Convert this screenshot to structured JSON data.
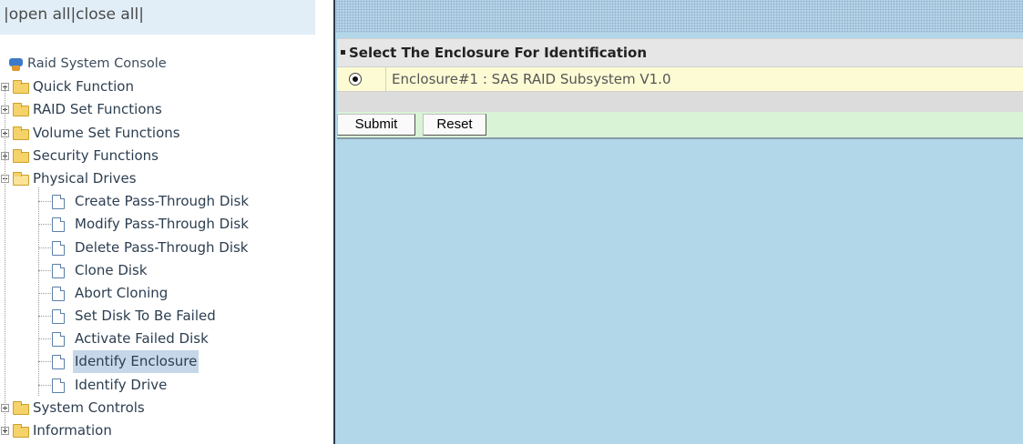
{
  "sidebar": {
    "open_all": "open all",
    "close_all": "close all",
    "pipe": "|",
    "tree": [
      {
        "label": "Raid System Console",
        "kind": "root"
      },
      {
        "label": "Quick Function",
        "kind": "folder",
        "expanded": false
      },
      {
        "label": "RAID Set Functions",
        "kind": "folder",
        "expanded": false
      },
      {
        "label": "Volume Set Functions",
        "kind": "folder",
        "expanded": false
      },
      {
        "label": "Security Functions",
        "kind": "folder",
        "expanded": false
      },
      {
        "label": "Physical Drives",
        "kind": "folder",
        "expanded": true
      },
      {
        "label": "Create Pass-Through Disk",
        "kind": "page"
      },
      {
        "label": "Modify Pass-Through Disk",
        "kind": "page"
      },
      {
        "label": "Delete Pass-Through Disk",
        "kind": "page"
      },
      {
        "label": "Clone Disk",
        "kind": "page"
      },
      {
        "label": "Abort Cloning",
        "kind": "page"
      },
      {
        "label": "Set Disk To Be Failed",
        "kind": "page"
      },
      {
        "label": "Activate Failed Disk",
        "kind": "page"
      },
      {
        "label": "Identify Enclosure",
        "kind": "page",
        "selected": true
      },
      {
        "label": "Identify Drive",
        "kind": "page"
      },
      {
        "label": "System Controls",
        "kind": "folder",
        "expanded": false
      },
      {
        "label": "Information",
        "kind": "folder",
        "expanded": false
      }
    ]
  },
  "main": {
    "panel_title": "Select The Enclosure For Identification",
    "enclosure_option": "Enclosure#1 : SAS RAID Subsystem V1.0",
    "enclosure_selected": true,
    "submit_label": "Submit",
    "reset_label": "Reset"
  },
  "colors": {
    "sidebar_header_bg": "#e1eef7",
    "main_bg": "#b1d7e8",
    "option_row_bg": "#fdfbd4",
    "button_row_bg": "#d9f3d6",
    "selected_item_bg": "#c5d7e9"
  }
}
